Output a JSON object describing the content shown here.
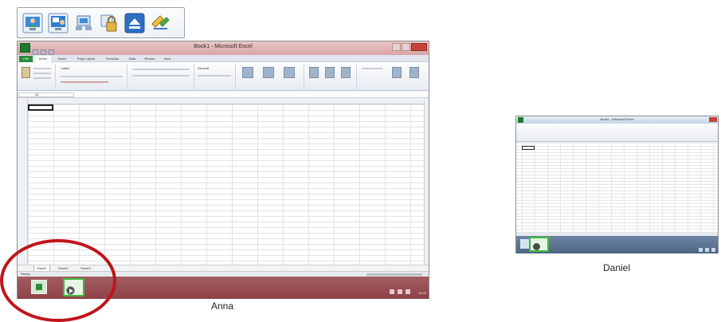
{
  "toolbar": {
    "buttons": [
      {
        "icon": "share-user-icon"
      },
      {
        "icon": "share-window-icon"
      },
      {
        "icon": "share-apps-icon"
      },
      {
        "icon": "lock-icon"
      },
      {
        "icon": "eject-icon"
      },
      {
        "icon": "pen-annotate-icon"
      }
    ]
  },
  "anna": {
    "caption": "Anna",
    "window_title": "Book1 - Microsoft Excel",
    "ribbon_tabs": [
      "File",
      "Home",
      "Insert",
      "Page Layout",
      "Formulas",
      "Data",
      "Review",
      "View"
    ],
    "font": "Calibri",
    "number_format": "General",
    "name_box": "A1",
    "col_headers": [
      "A",
      "B",
      "C",
      "D",
      "E",
      "F",
      "G",
      "H",
      "I",
      "J",
      "K",
      "L",
      "M",
      "N",
      "O",
      "P",
      "Q",
      "R"
    ],
    "row_count": 27,
    "sheet_tabs": [
      "Sheet1",
      "Sheet2",
      "Sheet3"
    ],
    "status": "Ready",
    "zoom": "100%",
    "tray_time": "12:45",
    "tray_date": "5/1/2012"
  },
  "daniel": {
    "caption": "Daniel",
    "window_title": "Book1 - Microsoft Excel"
  },
  "colors": {
    "anna_taskbar": "#9a5055",
    "daniel_taskbar": "#5b7595",
    "highlight": "#c0141b",
    "app_border": "#3dbb3d"
  }
}
